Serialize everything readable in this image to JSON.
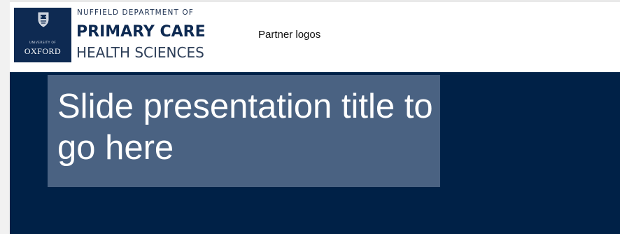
{
  "header": {
    "logo": {
      "small_text": "University of",
      "name": "OXFORD"
    },
    "department": {
      "line1": "NUFFIELD DEPARTMENT OF",
      "line2": "PRIMARY CARE",
      "line3": "HEALTH SCIENCES"
    },
    "partner_logos": "Partner logos"
  },
  "slide": {
    "title": "Slide presentation title to go here",
    "colors": {
      "background": "#002147",
      "title_box": "#4a6282",
      "title_text": "#ffffff"
    }
  }
}
